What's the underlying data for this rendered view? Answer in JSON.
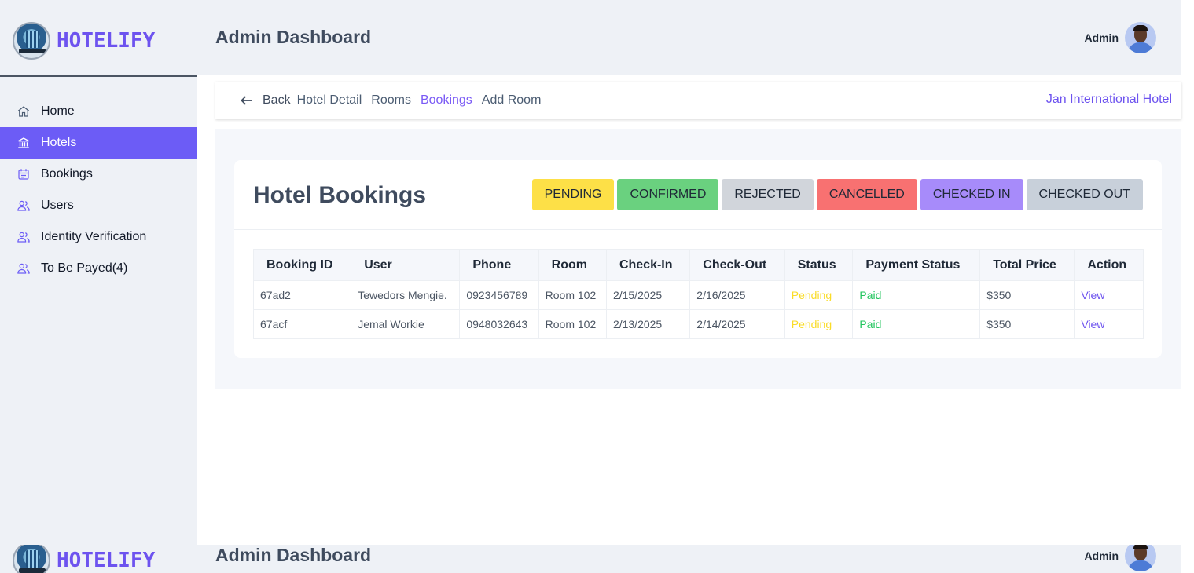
{
  "brand": {
    "name": "HOTELIFY",
    "logo_icon": "hotel-booking-logo"
  },
  "header": {
    "title": "Admin Dashboard",
    "user": "Admin"
  },
  "sidebar": {
    "items": [
      {
        "label": "Home",
        "icon": "home-icon",
        "active": false
      },
      {
        "label": "Hotels",
        "icon": "building-icon",
        "active": true
      },
      {
        "label": "Bookings",
        "icon": "calendar-icon",
        "active": false
      },
      {
        "label": "Users",
        "icon": "users-icon",
        "active": false
      },
      {
        "label": "Identity Verification",
        "icon": "users-icon",
        "active": false
      },
      {
        "label": "To Be Payed(4)",
        "icon": "users-icon",
        "active": false
      }
    ]
  },
  "subnav": {
    "back": "Back",
    "links": [
      {
        "label": "Hotel Detail",
        "active": false
      },
      {
        "label": "Rooms",
        "active": false
      },
      {
        "label": "Bookings",
        "active": true
      },
      {
        "label": "Add Room",
        "active": false
      }
    ],
    "hotel_name": "Jan International Hotel"
  },
  "bookings": {
    "title": "Hotel Bookings",
    "filters": [
      {
        "label": "PENDING",
        "color": "#fde047"
      },
      {
        "label": "CONFIRMED",
        "color": "#6ad17f"
      },
      {
        "label": "REJECTED",
        "color": "#d1d5db"
      },
      {
        "label": "CANCELLED",
        "color": "#f87171"
      },
      {
        "label": "CHECKED IN",
        "color": "#a78bfa"
      },
      {
        "label": "CHECKED OUT",
        "color": "#c8d0da"
      }
    ],
    "columns": [
      "Booking ID",
      "User",
      "Phone",
      "Room",
      "Check-In",
      "Check-Out",
      "Status",
      "Payment Status",
      "Total Price",
      "Action"
    ],
    "rows": [
      [
        "67ad2",
        "Tewedors Mengie.",
        "0923456789",
        "Room 102",
        "2/15/2025",
        "2/16/2025",
        "Pending",
        "Paid",
        "$350",
        "View"
      ],
      [
        "67acf",
        "Jemal Workie",
        "0948032643",
        "Room 102",
        "2/13/2025",
        "2/14/2025",
        "Pending",
        "Paid",
        "$350",
        "View"
      ]
    ]
  },
  "colors": {
    "accent": "#6c5cf6",
    "pending": "#fadc28",
    "paid": "#22c55e",
    "link": "#6d53ef"
  }
}
